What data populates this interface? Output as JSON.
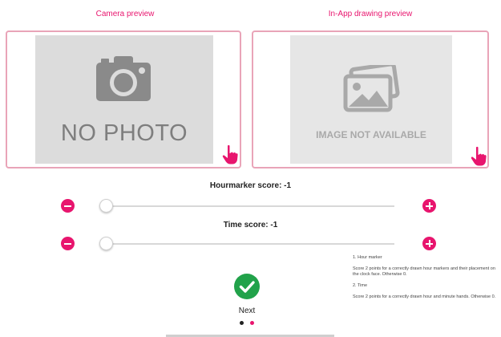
{
  "captions": {
    "camera": "Camera preview",
    "drawing": "In-App drawing preview"
  },
  "placeholders": {
    "camera": "NO PHOTO",
    "drawing": "IMAGE NOT AVAILABLE"
  },
  "scores": {
    "hourmarker_label": "Hourmarker score: -1",
    "hourmarker_value": -1,
    "time_label": "Time score: -1",
    "time_value": -1
  },
  "next": {
    "label": "Next"
  },
  "pagination": {
    "count": 2,
    "active_index": 1
  },
  "instructions": [
    "1. Hour marker",
    "Score 2 points for a correctly drawn hour markers and their placement on the clock face. Otherwise 0.",
    "2. Time",
    "Score 2 points for a correctly drawn hour and minute hands. Otherwise 0."
  ],
  "colors": {
    "accent": "#e8156e",
    "panel_border": "#e9a4b8",
    "success": "#21a24a"
  },
  "icons": {
    "camera": "camera-icon",
    "image": "image-icon",
    "hand": "hand-pointer-icon",
    "minus": "minus-circle-icon",
    "plus": "plus-circle-icon",
    "check": "check-icon"
  }
}
